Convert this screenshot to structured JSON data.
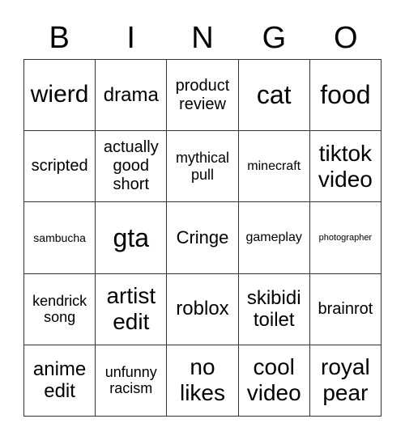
{
  "header": [
    "B",
    "I",
    "N",
    "G",
    "O"
  ],
  "cells": [
    [
      "wierd",
      "drama",
      "product review",
      "cat",
      "food"
    ],
    [
      "scripted",
      "actually good short",
      "mythical pull",
      "minecraft",
      "tiktok video"
    ],
    [
      "sambucha",
      "gta",
      "Cringe",
      "gameplay",
      "photographer"
    ],
    [
      "kendrick song",
      "artist edit",
      "roblox",
      "skibidi toilet",
      "brainrot"
    ],
    [
      "anime edit",
      "unfunny racism",
      "no likes",
      "cool video",
      "royal pear"
    ]
  ]
}
